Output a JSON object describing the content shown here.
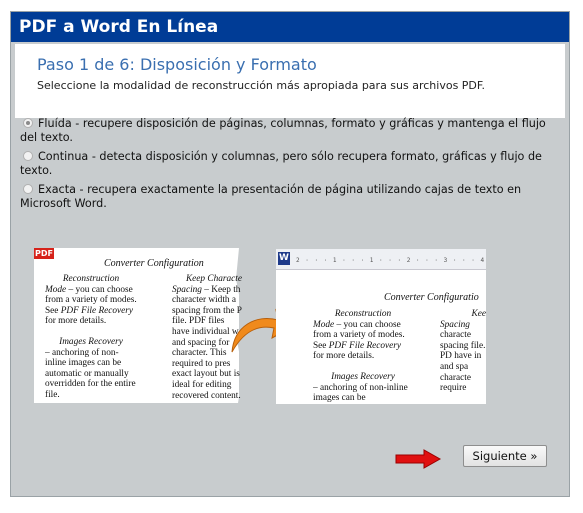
{
  "window": {
    "title": "PDF a Word En Línea"
  },
  "step": {
    "title": "Paso 1 de 6: Disposición y Formato",
    "subtitle": "Seleccione la modalidad de reconstrucción más apropiada para sus archivos PDF."
  },
  "options": [
    {
      "label": "Fluída - recupere disposición de páginas, columnas, formato y gráficas y mantenga el flujo del texto.",
      "selected": true
    },
    {
      "label": "Continua - detecta disposición y columnas, pero sólo recupera formato, gráficas y flujo de texto.",
      "selected": false
    },
    {
      "label": "Exacta - recupera exactamente la presentación de página utilizando cajas de texto en Microsoft Word.",
      "selected": false
    }
  ],
  "illustration": {
    "pdf_badge": "PDF",
    "word_badge": "W",
    "ruler_text": "2 · · · 1 · · · 1 · · · 2 · · · 3 · · · 4",
    "pdf_heading": "Converter Configuration",
    "word_heading": "Converter Configuratio",
    "pdf_col1": {
      "title": "Reconstruction",
      "body_lead": "Mode",
      "body": " – you can choose from a variety of modes. See ",
      "link": "PDF File Recovery",
      "body_end": " for more details.",
      "title2": "Images Recovery",
      "body2": "– anchoring of non-inline images can be automatic or manually overridden for the entire file."
    },
    "pdf_col2": {
      "title": "Keep Characte",
      "title_lead": "Spacing",
      "body": " – Keep th character width a spacing from the P file. PDF files have individual w and spacing for character. This required to pres exact layout but is ideal for editing recovered content."
    },
    "word_col1": {
      "title": "Reconstruction",
      "body_lead": "Mode",
      "body": " – you can choose from a variety of modes. See ",
      "link": "PDF File Recovery",
      "body_end": " for more details.",
      "title2": "Images Recovery",
      "body2": "– anchoring of non-inline images can be"
    },
    "word_col2": {
      "title": "Kee",
      "title_lead": "Spacing",
      "body": " characte spacing file. PD have in and spa characte require"
    }
  },
  "footer": {
    "next_label": "Siguiente »"
  },
  "colors": {
    "titlebar": "#003c96",
    "step_title": "#3a6fb0",
    "panel": "#c8ccce",
    "arrow_red": "#e01010",
    "curve_arrow": "#f08a1c"
  }
}
